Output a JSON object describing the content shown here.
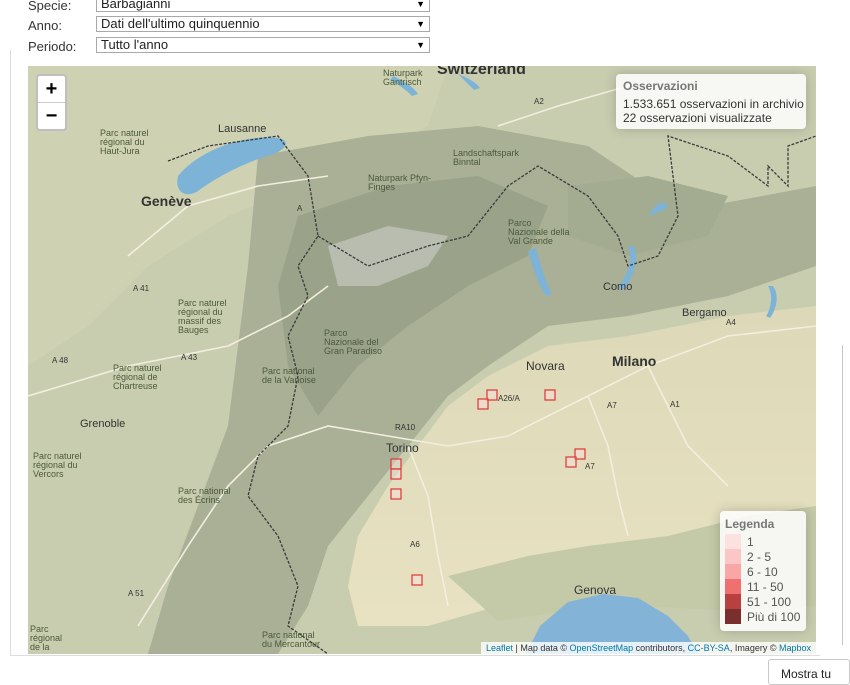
{
  "form": {
    "specie": {
      "label": "Specie:",
      "value": "Barbagianni"
    },
    "anno": {
      "label": "Anno:",
      "value": "Dati dell'ultimo quinquennio"
    },
    "periodo": {
      "label": "Periodo:",
      "value": "Tutto l'anno"
    }
  },
  "map": {
    "zoom_in": "+",
    "zoom_out": "−",
    "info": {
      "title": "Osservazioni",
      "line1": "1.533.651 osservazioni in archivio",
      "line2": "22 osservazioni visualizzate"
    },
    "legend": {
      "title": "Legenda",
      "items": [
        {
          "label": "1",
          "color": "#fde0e0"
        },
        {
          "label": "2 - 5",
          "color": "#fbc6c6"
        },
        {
          "label": "6 - 10",
          "color": "#f8a6a6"
        },
        {
          "label": "11 - 50",
          "color": "#f07070"
        },
        {
          "label": "51 - 100",
          "color": "#b84040"
        },
        {
          "label": "Più di 100",
          "color": "#7a2e2e"
        }
      ]
    },
    "attribution": {
      "leaflet": "Leaflet",
      "map_data": " | Map data © ",
      "osm": "OpenStreetMap",
      "contributors": " contributors, ",
      "license": "CC-BY-SA",
      "imagery": ", Imagery © ",
      "mapbox": "Mapbox"
    },
    "cities": {
      "lausanne": "Lausanne",
      "geneve": "Genève",
      "switzerland": "Switzerland",
      "como": "Como",
      "bergamo": "Bergamo",
      "novara": "Novara",
      "milano": "Milano",
      "torino": "Torino",
      "grenoble": "Grenoble",
      "genova": "Genova"
    },
    "parks": {
      "gantrisch": "Naturpark\nGantrisch",
      "haut_jura": "Parc naturel\nrégional du\nHaut-Jura",
      "pfyn": "Naturpark Pfyn-\nFinges",
      "binntal": "Landschaftspark\nBinntal",
      "val_grande": "Parco\nNazionale della\nVal Grande",
      "bauges": "Parc naturel\nrégional du\nmassif des\nBauges",
      "chartreuse": "Parc naturel\nrégional de\nChartreuse",
      "gran_paradiso": "Parco\nNazionale del\nGran Paradiso",
      "vanoise": "Parc national\nde la Vanoise",
      "vercors": "Parc naturel\nrégional du\nVercors",
      "ecrins": "Parc national\ndes Écrins",
      "mercantour": "Parc national\ndu Mercantour",
      "regional_frag": "Parc\nrégional\nde la"
    },
    "roads": [
      "A2",
      "A",
      "A 41",
      "A 48",
      "A 43",
      "RA10",
      "A26/A",
      "A7",
      "A1",
      "A4",
      "A6",
      "A 51",
      "A7"
    ],
    "observations_count": 22
  },
  "footer": {
    "mostra_button": "Mostra tu"
  }
}
